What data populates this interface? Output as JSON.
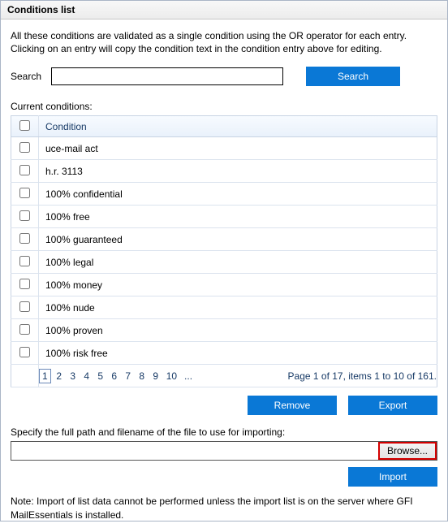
{
  "window": {
    "title": "Conditions list"
  },
  "help": {
    "line1": "All these conditions are validated as a single condition using the OR operator for each entry.",
    "line2": "Clicking on an entry will copy the condition text in the condition entry above for editing."
  },
  "search": {
    "label": "Search",
    "value": "",
    "button": "Search"
  },
  "conditions": {
    "label": "Current conditions:",
    "header": "Condition",
    "rows": [
      {
        "checked": false,
        "text": "uce-mail act"
      },
      {
        "checked": false,
        "text": "h.r. 3113"
      },
      {
        "checked": false,
        "text": "100% confidential"
      },
      {
        "checked": false,
        "text": "100% free"
      },
      {
        "checked": false,
        "text": "100% guaranteed"
      },
      {
        "checked": false,
        "text": "100% legal"
      },
      {
        "checked": false,
        "text": "100% money"
      },
      {
        "checked": false,
        "text": "100% nude"
      },
      {
        "checked": false,
        "text": "100% proven"
      },
      {
        "checked": false,
        "text": "100% risk free"
      }
    ],
    "pager": {
      "pages": [
        "1",
        "2",
        "3",
        "4",
        "5",
        "6",
        "7",
        "8",
        "9",
        "10",
        "..."
      ],
      "current": "1",
      "status": "Page 1 of 17, items 1 to 10 of 161."
    }
  },
  "buttons": {
    "remove": "Remove",
    "export": "Export",
    "browse": "Browse...",
    "import": "Import"
  },
  "import": {
    "label": "Specify the full path and filename of the file to use for importing:",
    "value": ""
  },
  "note": "Note: Import of list data cannot be performed unless the import list is on the server where GFI MailEssentials is installed."
}
